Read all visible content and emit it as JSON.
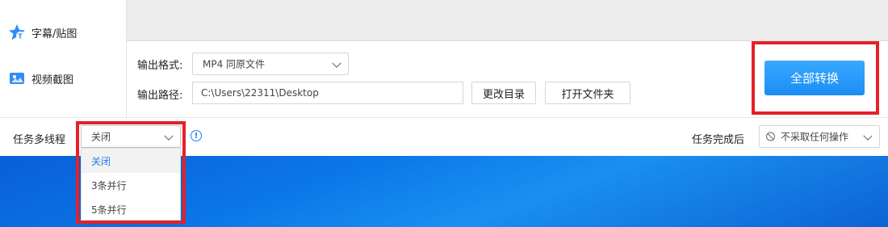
{
  "sidebar": {
    "items": [
      {
        "label": "字幕/贴图",
        "icon": "star-t-icon"
      },
      {
        "label": "视频截图",
        "icon": "image-icon"
      }
    ]
  },
  "output": {
    "format_label": "输出格式:",
    "format_value": "MP4  同原文件",
    "path_label": "输出路径:",
    "path_value": "C:\\Users\\22311\\Desktop",
    "change_dir_label": "更改目录",
    "open_folder_label": "打开文件夹"
  },
  "convert_all_label": "全部转换",
  "bottom": {
    "multithread_label": "任务多线程",
    "multithread_value": "关闭",
    "options": [
      "关闭",
      "3条并行",
      "5条并行"
    ],
    "after_label": "任务完成后",
    "after_value": "不采取任何操作"
  },
  "colors": {
    "accent": "#1a8ff2",
    "highlight": "#e3212a"
  }
}
